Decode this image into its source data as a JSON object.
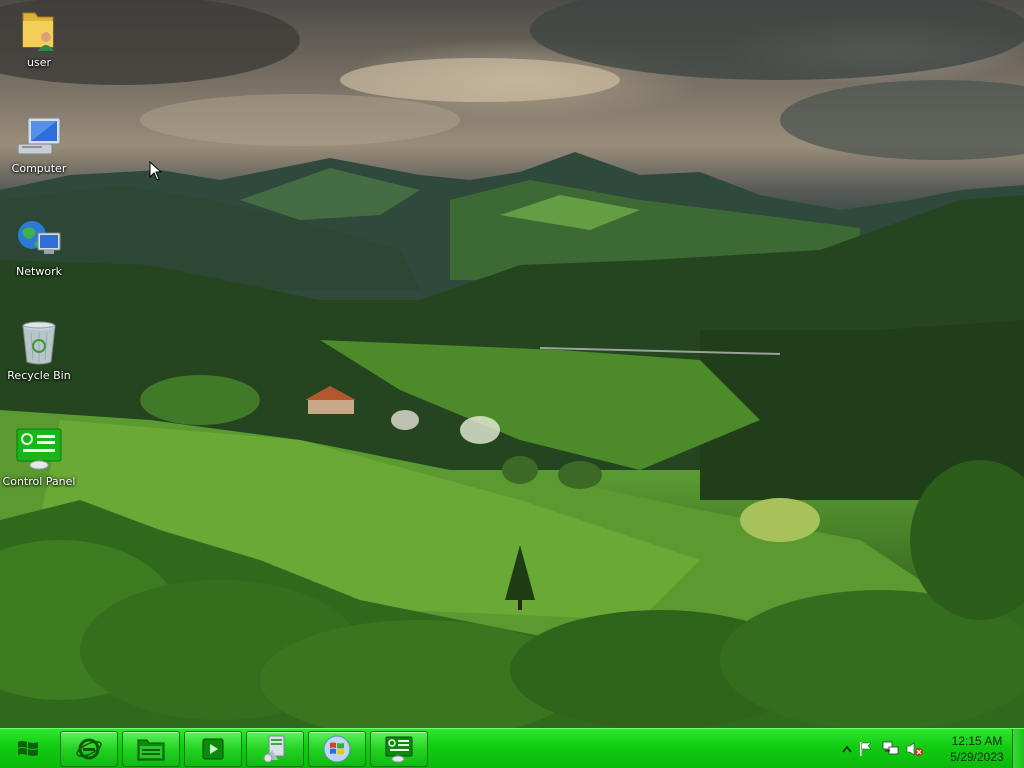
{
  "desktop": {
    "icons": [
      {
        "label": "user",
        "icon": "user-folder-icon"
      },
      {
        "label": "Computer",
        "icon": "computer-icon"
      },
      {
        "label": "Network",
        "icon": "network-icon"
      },
      {
        "label": "Recycle Bin",
        "icon": "recycle-bin-icon"
      },
      {
        "label": "Control Panel",
        "icon": "control-panel-icon"
      }
    ]
  },
  "taskbar": {
    "start_icon": "windows-flag-icon",
    "pinned": [
      {
        "name": "Internet Explorer",
        "icon": "internet-explorer-icon"
      },
      {
        "name": "Windows Explorer",
        "icon": "folder-icon"
      },
      {
        "name": "Media Player",
        "icon": "media-player-icon"
      },
      {
        "name": "Documents",
        "icon": "document-icon"
      },
      {
        "name": "Start Orb",
        "icon": "windows-orb-icon"
      },
      {
        "name": "Control Panel",
        "icon": "control-panel-icon"
      }
    ],
    "tray": {
      "icons": [
        "show-hidden-icons-chevron",
        "action-center-flag-icon",
        "network-icon",
        "volume-muted-icon"
      ],
      "time": "12:15 AM",
      "date": "5/29/2023"
    }
  },
  "colors": {
    "taskbar": "#12cc12",
    "icon_label": "#ffffff"
  }
}
